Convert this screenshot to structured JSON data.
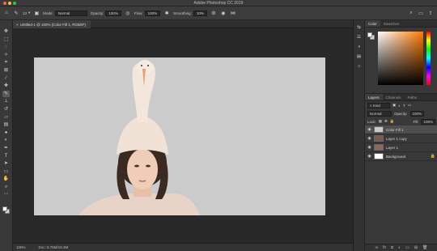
{
  "window": {
    "title": "Adobe Photoshop CC 2019",
    "traffic_lights": [
      "#ff5f57",
      "#febc2e",
      "#28c840"
    ]
  },
  "options_bar": {
    "mode_label": "Mode:",
    "mode_value": "Normal",
    "opacity_label": "Opacity:",
    "opacity_value": "100%",
    "flow_label": "Flow:",
    "flow_value": "100%",
    "smoothing_label": "Smoothing:",
    "smoothing_value": "10%",
    "brush_size": "13"
  },
  "document_tab": {
    "title": "Untitled-1 @ 100% (Color Fill 1, RGB/8*)",
    "close": "×"
  },
  "status_bar": {
    "zoom": "100%",
    "doc_info": "Doc: 8.75M/19.4M"
  },
  "color_panel": {
    "tabs": [
      "Color",
      "Swatches"
    ],
    "foreground": "#ffffff",
    "background": "#e6d0cc"
  },
  "layers_panel": {
    "tabs": [
      "Layers",
      "Channels",
      "Paths"
    ],
    "filter_label": "Kind",
    "blend_mode": "Normal",
    "opacity_label": "Opacity:",
    "opacity_value": "100%",
    "lock_label": "Lock:",
    "fill_label": "Fill:",
    "fill_value": "100%",
    "layers": [
      {
        "name": "Color Fill 1",
        "selected": true
      },
      {
        "name": "Layer 1 copy",
        "selected": false
      },
      {
        "name": "Layer 1",
        "selected": false
      },
      {
        "name": "Background",
        "selected": false
      }
    ]
  },
  "canvas": {
    "background": "#cbcbcb"
  }
}
